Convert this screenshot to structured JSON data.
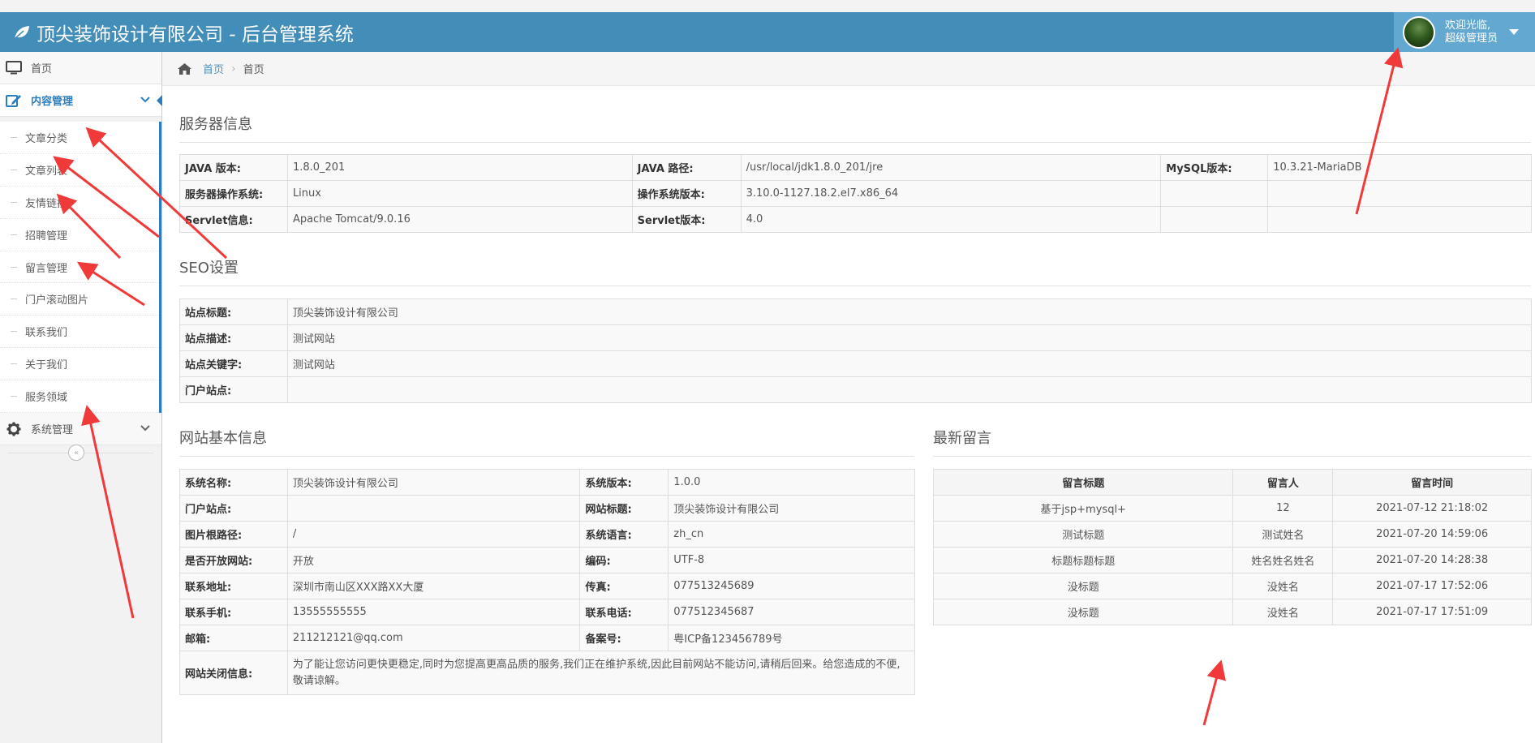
{
  "app": {
    "title": "顶尖装饰设计有限公司 - 后台管理系统",
    "welcome_line1": "欢迎光临,",
    "welcome_line2": "超级管理员"
  },
  "sidebar": {
    "home": "首页",
    "content": "内容管理",
    "content_items": [
      "文章分类",
      "文章列表",
      "友情链接",
      "招聘管理",
      "留言管理",
      "门户滚动图片",
      "联系我们",
      "关于我们",
      "服务领域"
    ],
    "system": "系统管理",
    "collapse_glyph": "«"
  },
  "breadcrumb": {
    "home": "首页",
    "current": "首页"
  },
  "server": {
    "title": "服务器信息",
    "rows": [
      [
        "JAVA 版本:",
        "1.8.0_201",
        "JAVA 路径:",
        "/usr/local/jdk1.8.0_201/jre",
        "MySQL版本:",
        "10.3.21-MariaDB"
      ],
      [
        "服务器操作系统:",
        "Linux",
        "操作系统版本:",
        "3.10.0-1127.18.2.el7.x86_64",
        "",
        ""
      ],
      [
        "Servlet信息:",
        "Apache Tomcat/9.0.16",
        "Servlet版本:",
        "4.0",
        "",
        ""
      ]
    ]
  },
  "seo": {
    "title": "SEO设置",
    "rows": [
      [
        "站点标题:",
        "顶尖装饰设计有限公司"
      ],
      [
        "站点描述:",
        "测试网站"
      ],
      [
        "站点关键字:",
        "测试网站"
      ],
      [
        "门户站点:",
        ""
      ]
    ]
  },
  "basic": {
    "title": "网站基本信息",
    "rows": [
      [
        "系统名称:",
        "顶尖装饰设计有限公司",
        "系统版本:",
        "1.0.0"
      ],
      [
        "门户站点:",
        "",
        "网站标题:",
        "顶尖装饰设计有限公司"
      ],
      [
        "图片根路径:",
        "/",
        "系统语言:",
        "zh_cn"
      ],
      [
        "是否开放网站:",
        "开放",
        "编码:",
        "UTF-8"
      ],
      [
        "联系地址:",
        "深圳市南山区XXX路XX大厦",
        "传真:",
        "077513245689"
      ],
      [
        "联系手机:",
        "13555555555",
        "联系电话:",
        "077512345687"
      ],
      [
        "邮箱:",
        "211212121@qq.com",
        "备案号:",
        "粤ICP备123456789号"
      ]
    ],
    "close_label": "网站关闭信息:",
    "close_text": "为了能让您访问更快更稳定,同时为您提高更高品质的服务,我们正在维护系统,因此目前网站不能访问,请稍后回来。给您造成的不便,敬请谅解。"
  },
  "messages": {
    "title": "最新留言",
    "headers": [
      "留言标题",
      "留言人",
      "留言时间"
    ],
    "rows": [
      [
        "基于jsp+mysql+",
        "12",
        "2021-07-12 21:18:02"
      ],
      [
        "测试标题",
        "测试姓名",
        "2021-07-20 14:59:06"
      ],
      [
        "标题标题标题",
        "姓名姓名姓名",
        "2021-07-20 14:28:38"
      ],
      [
        "没标题",
        "没姓名",
        "2021-07-17 17:52:06"
      ],
      [
        "没标题",
        "没姓名",
        "2021-07-17 17:51:09"
      ]
    ]
  },
  "colors": {
    "navbar": "#438eb9",
    "user_box": "#62a8d1",
    "accent": "#2b7dbc",
    "annotation_arrow": "#f03a3a"
  }
}
